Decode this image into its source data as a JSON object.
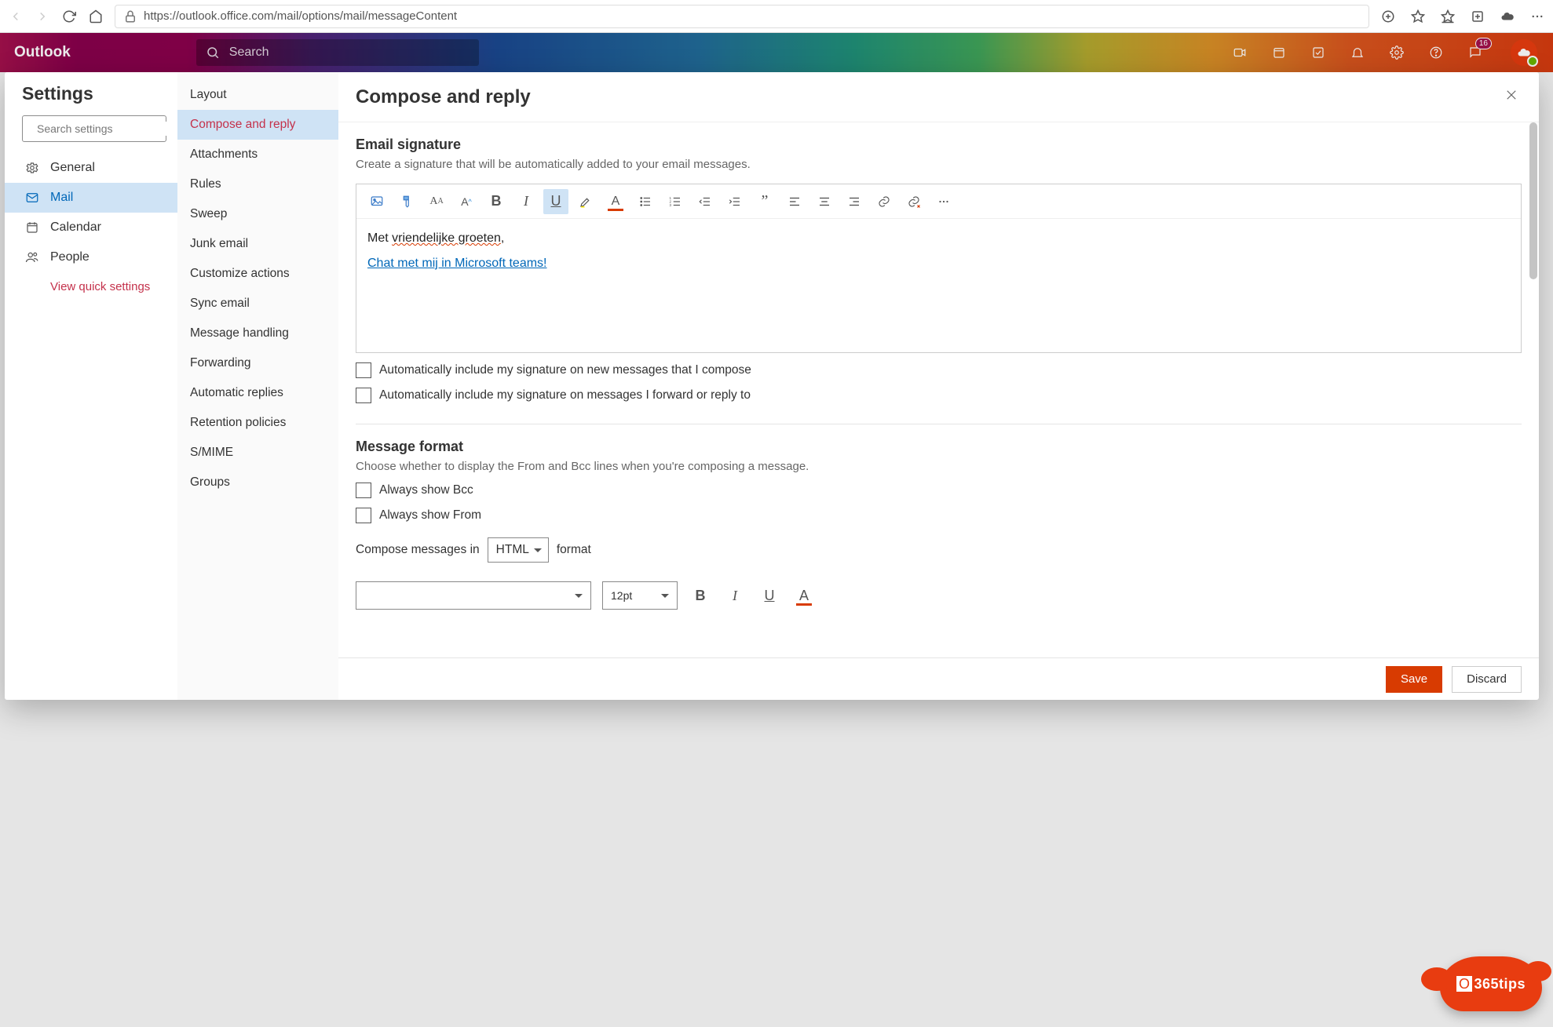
{
  "browser": {
    "url": "https://outlook.office.com/mail/options/mail/messageContent"
  },
  "header": {
    "brand": "Outlook",
    "search_placeholder": "Search",
    "notification_badge": "16"
  },
  "settings_panel": {
    "title": "Settings",
    "search_placeholder": "Search settings",
    "categories": [
      {
        "id": "general",
        "label": "General",
        "selected": false
      },
      {
        "id": "mail",
        "label": "Mail",
        "selected": true
      },
      {
        "id": "calendar",
        "label": "Calendar",
        "selected": false
      },
      {
        "id": "people",
        "label": "People",
        "selected": false
      }
    ],
    "quick_link": "View quick settings"
  },
  "subnav": {
    "items": [
      {
        "label": "Layout",
        "selected": false
      },
      {
        "label": "Compose and reply",
        "selected": true
      },
      {
        "label": "Attachments",
        "selected": false
      },
      {
        "label": "Rules",
        "selected": false
      },
      {
        "label": "Sweep",
        "selected": false
      },
      {
        "label": "Junk email",
        "selected": false
      },
      {
        "label": "Customize actions",
        "selected": false
      },
      {
        "label": "Sync email",
        "selected": false
      },
      {
        "label": "Message handling",
        "selected": false
      },
      {
        "label": "Forwarding",
        "selected": false
      },
      {
        "label": "Automatic replies",
        "selected": false
      },
      {
        "label": "Retention policies",
        "selected": false
      },
      {
        "label": "S/MIME",
        "selected": false
      },
      {
        "label": "Groups",
        "selected": false
      }
    ]
  },
  "main": {
    "title": "Compose and reply",
    "signature": {
      "heading": "Email signature",
      "desc": "Create a signature that will be automatically added to your email messages.",
      "line1_prefix": "Met ",
      "line1_err": "vriendelijke groeten",
      "line1_suffix": ",",
      "line2_link": "Chat met mij in Microsoft teams!",
      "chk_new": "Automatically include my signature on new messages that I compose",
      "chk_reply": "Automatically include my signature on messages I forward or reply to"
    },
    "format": {
      "heading": "Message format",
      "desc": "Choose whether to display the From and Bcc lines when you're composing a message.",
      "chk_bcc": "Always show Bcc",
      "chk_from": "Always show From",
      "compose_prefix": "Compose messages in",
      "compose_value": "HTML",
      "compose_suffix": "format",
      "font_size": "12pt"
    },
    "footer": {
      "save": "Save",
      "discard": "Discard"
    }
  },
  "overlay": {
    "tips": "365tips"
  }
}
